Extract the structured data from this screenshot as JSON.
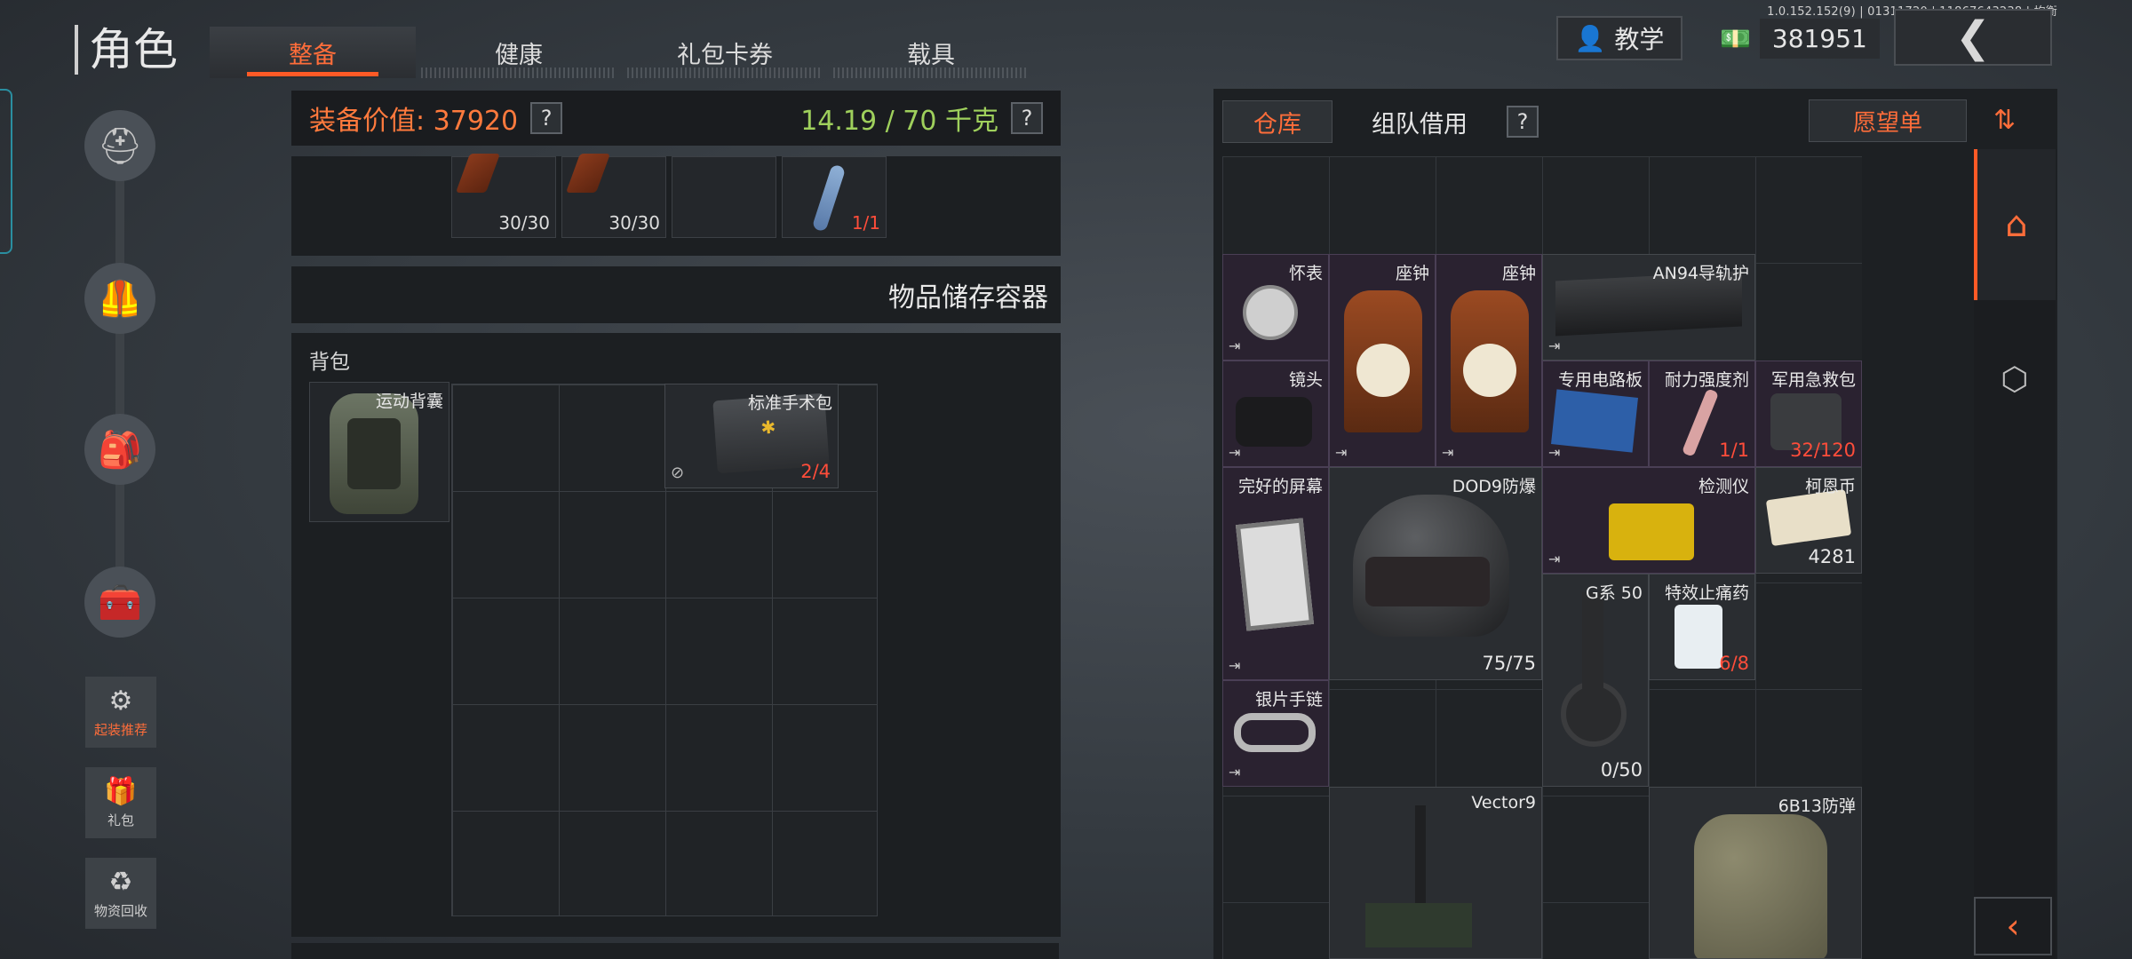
{
  "version": "1.0.152.152(9) | 01311720 | 11867643238 | 均衡",
  "page_title": "角色",
  "tabs": [
    "整备",
    "健康",
    "礼包卡券",
    "载具"
  ],
  "teach_label": "教学",
  "money": "381951",
  "equip": {
    "value_label": "装备价值: 37920",
    "weight": "14.19 / 70 千克",
    "help": "?"
  },
  "ammo": [
    {
      "count": "30/30"
    },
    {
      "count": "30/30"
    },
    {
      "count": ""
    },
    {
      "count": "1/1"
    }
  ],
  "storage_title": "物品储存容器",
  "bag": {
    "label": "背包",
    "bag_name": "运动背囊",
    "medkit_name": "标准手术包",
    "medkit_count": "2/4"
  },
  "side_buttons": [
    "起装推荐",
    "礼包",
    "物资回收"
  ],
  "right": {
    "tab_warehouse": "仓库",
    "tab_team": "组队借用",
    "wishlist": "愿望单",
    "items": [
      {
        "name": "怀表",
        "count": ""
      },
      {
        "name": "座钟",
        "count": ""
      },
      {
        "name": "座钟",
        "count": ""
      },
      {
        "name": "AN94导轨护",
        "count": ""
      },
      {
        "name": "镜头",
        "count": ""
      },
      {
        "name": "专用电路板",
        "count": ""
      },
      {
        "name": "耐力强度剂",
        "count": "1/1"
      },
      {
        "name": "军用急救包",
        "count": "32/120"
      },
      {
        "name": "完好的屏幕",
        "count": ""
      },
      {
        "name": "DOD9防爆",
        "count": "75/75"
      },
      {
        "name": "检测仪",
        "count": ""
      },
      {
        "name": "柯恩币",
        "count": "4281"
      },
      {
        "name": "G系 50",
        "count": "0/50"
      },
      {
        "name": "特效止痛药",
        "count": "6/8"
      },
      {
        "name": "银片手链",
        "count": ""
      },
      {
        "name": "Vector9",
        "count": ""
      },
      {
        "name": "6B13防弹",
        "count": ""
      }
    ]
  }
}
